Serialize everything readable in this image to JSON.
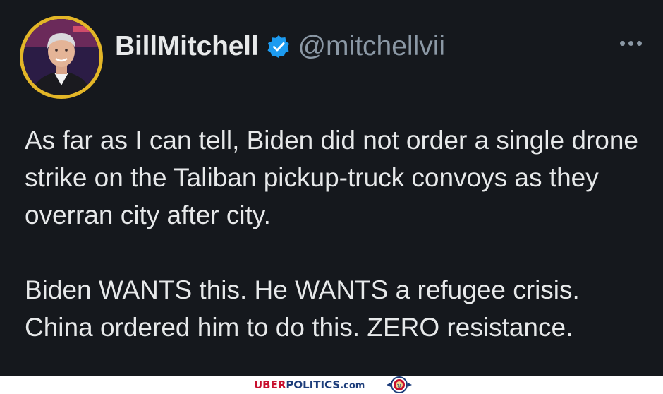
{
  "tweet": {
    "display_name": "BillMitchell",
    "handle": "@mitchellvii",
    "verified": true,
    "paragraph1": "As far as I can tell, Biden did not order a single drone strike on the Taliban pickup-truck convoys as they overran city after city.",
    "paragraph2": "Biden WANTS this. He WANTS a refugee crisis. China ordered him to do this. ZERO resistance.",
    "more_icon": "ellipsis-icon",
    "verified_icon": "verified-badge-icon"
  },
  "watermark": {
    "uber": "UBER",
    "politics": "POLITICS",
    "domain_suffix": ".com",
    "logo_icon": "lion-seal-icon"
  },
  "colors": {
    "background": "#15181d",
    "text": "#e7e9ea",
    "secondary_text": "#8b98a5",
    "verified_blue": "#1d9bf0",
    "avatar_ring": "#e3b627",
    "brand_red": "#c8102e",
    "brand_blue": "#1d3d7a"
  }
}
